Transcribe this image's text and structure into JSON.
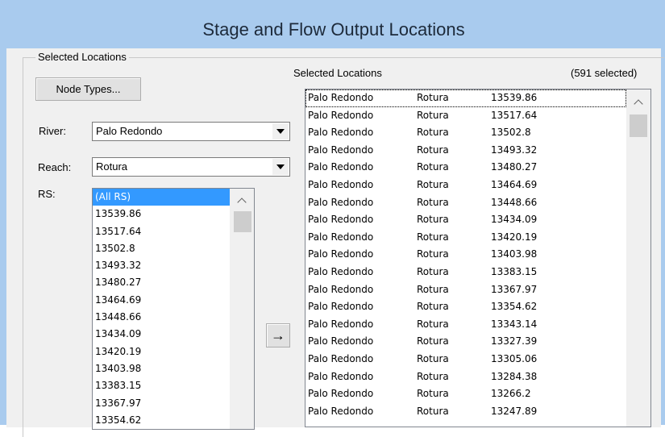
{
  "window": {
    "title": "Stage and Flow Output Locations"
  },
  "left_group": {
    "legend": "Selected Locations"
  },
  "node_types_button": "Node Types...",
  "river": {
    "label": "River:",
    "value": "Palo Redondo"
  },
  "reach": {
    "label": "Reach:",
    "value": "Rotura"
  },
  "rs": {
    "label": "RS:",
    "items": [
      "(All RS)",
      "13539.86",
      "13517.64",
      "13502.8",
      "13493.32",
      "13480.27",
      "13464.69",
      "13448.66",
      "13434.09",
      "13420.19",
      "13403.98",
      "13383.15",
      "13367.97",
      "13354.62"
    ],
    "selected_index": 0
  },
  "add_button": {
    "icon": "arrow-right-icon",
    "glyph": "→"
  },
  "selected_panel": {
    "label": "Selected Locations",
    "count": "(591 selected)",
    "rows": [
      [
        "Palo Redondo",
        "Rotura",
        "13539.86"
      ],
      [
        "Palo Redondo",
        "Rotura",
        "13517.64"
      ],
      [
        "Palo Redondo",
        "Rotura",
        "13502.8"
      ],
      [
        "Palo Redondo",
        "Rotura",
        "13493.32"
      ],
      [
        "Palo Redondo",
        "Rotura",
        "13480.27"
      ],
      [
        "Palo Redondo",
        "Rotura",
        "13464.69"
      ],
      [
        "Palo Redondo",
        "Rotura",
        "13448.66"
      ],
      [
        "Palo Redondo",
        "Rotura",
        "13434.09"
      ],
      [
        "Palo Redondo",
        "Rotura",
        "13420.19"
      ],
      [
        "Palo Redondo",
        "Rotura",
        "13403.98"
      ],
      [
        "Palo Redondo",
        "Rotura",
        "13383.15"
      ],
      [
        "Palo Redondo",
        "Rotura",
        "13367.97"
      ],
      [
        "Palo Redondo",
        "Rotura",
        "13354.62"
      ],
      [
        "Palo Redondo",
        "Rotura",
        "13343.14"
      ],
      [
        "Palo Redondo",
        "Rotura",
        "13327.39"
      ],
      [
        "Palo Redondo",
        "Rotura",
        "13305.06"
      ],
      [
        "Palo Redondo",
        "Rotura",
        "13284.38"
      ],
      [
        "Palo Redondo",
        "Rotura",
        "13266.2"
      ],
      [
        "Palo Redondo",
        "Rotura",
        "13247.89"
      ]
    ]
  },
  "colors": {
    "title_bar": "#a9cbee",
    "selection": "#3399ff",
    "dialog_bg": "#f0f0f0"
  }
}
